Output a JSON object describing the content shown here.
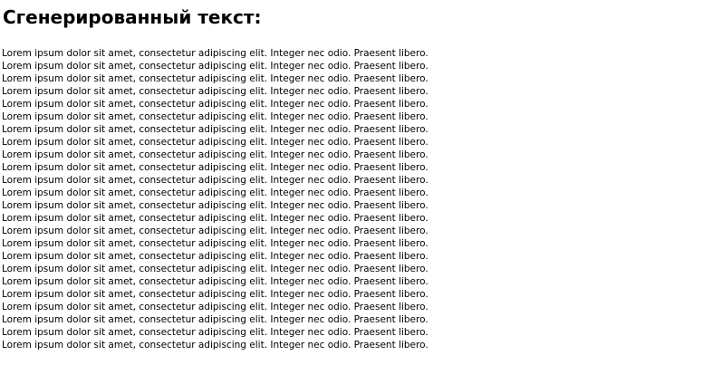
{
  "heading": "Сгенерированный текст:",
  "paragraph_lines": [
    "Lorem ipsum dolor sit amet, consectetur adipiscing elit. Integer nec odio. Praesent libero.",
    "Lorem ipsum dolor sit amet, consectetur adipiscing elit. Integer nec odio. Praesent libero.",
    "Lorem ipsum dolor sit amet, consectetur adipiscing elit. Integer nec odio. Praesent libero.",
    "Lorem ipsum dolor sit amet, consectetur adipiscing elit. Integer nec odio. Praesent libero.",
    "Lorem ipsum dolor sit amet, consectetur adipiscing elit. Integer nec odio. Praesent libero.",
    "Lorem ipsum dolor sit amet, consectetur adipiscing elit. Integer nec odio. Praesent libero.",
    "Lorem ipsum dolor sit amet, consectetur adipiscing elit. Integer nec odio. Praesent libero.",
    "Lorem ipsum dolor sit amet, consectetur adipiscing elit. Integer nec odio. Praesent libero.",
    "Lorem ipsum dolor sit amet, consectetur adipiscing elit. Integer nec odio. Praesent libero.",
    "Lorem ipsum dolor sit amet, consectetur adipiscing elit. Integer nec odio. Praesent libero.",
    "Lorem ipsum dolor sit amet, consectetur adipiscing elit. Integer nec odio. Praesent libero.",
    "Lorem ipsum dolor sit amet, consectetur adipiscing elit. Integer nec odio. Praesent libero.",
    "Lorem ipsum dolor sit amet, consectetur adipiscing elit. Integer nec odio. Praesent libero.",
    "Lorem ipsum dolor sit amet, consectetur adipiscing elit. Integer nec odio. Praesent libero.",
    "Lorem ipsum dolor sit amet, consectetur adipiscing elit. Integer nec odio. Praesent libero.",
    "Lorem ipsum dolor sit amet, consectetur adipiscing elit. Integer nec odio. Praesent libero.",
    "Lorem ipsum dolor sit amet, consectetur adipiscing elit. Integer nec odio. Praesent libero.",
    "Lorem ipsum dolor sit amet, consectetur adipiscing elit. Integer nec odio. Praesent libero.",
    "Lorem ipsum dolor sit amet, consectetur adipiscing elit. Integer nec odio. Praesent libero.",
    "Lorem ipsum dolor sit amet, consectetur adipiscing elit. Integer nec odio. Praesent libero.",
    "Lorem ipsum dolor sit amet, consectetur adipiscing elit. Integer nec odio. Praesent libero.",
    "Lorem ipsum dolor sit amet, consectetur adipiscing elit. Integer nec odio. Praesent libero.",
    "Lorem ipsum dolor sit amet, consectetur adipiscing elit. Integer nec odio. Praesent libero.",
    "Lorem ipsum dolor sit amet, consectetur adipiscing elit. Integer nec odio. Praesent libero."
  ],
  "colors": {
    "background": "#ffffff",
    "text": "#000000"
  }
}
